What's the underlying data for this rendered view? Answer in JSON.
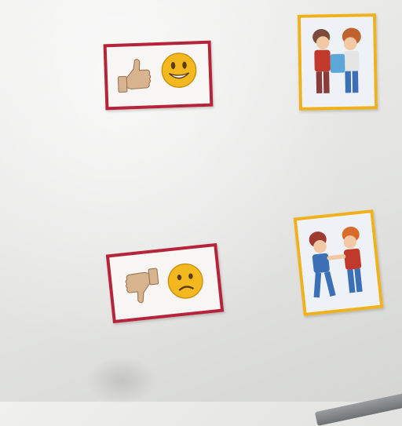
{
  "scene": {
    "surface": "whiteboard",
    "cards": [
      {
        "kind": "thumbs-up-smiley",
        "border_color": "#b5243a",
        "icons": [
          "thumbs-up-icon",
          "smiling-face-icon"
        ]
      },
      {
        "kind": "kids-sharing-picture",
        "border_color": "#f0b11e"
      },
      {
        "kind": "thumbs-down-frown",
        "border_color": "#b5243a",
        "icons": [
          "thumbs-down-icon",
          "frowning-face-icon"
        ]
      },
      {
        "kind": "kids-pushing-picture",
        "border_color": "#f0b11e"
      }
    ]
  }
}
